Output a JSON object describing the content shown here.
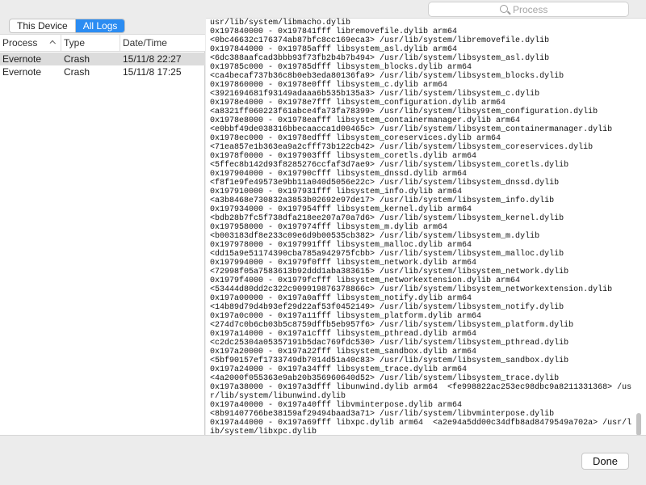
{
  "toolbar": {
    "segments": [
      "This Device",
      "All Logs"
    ],
    "active_segment": "All Logs",
    "search_placeholder": "Process"
  },
  "table": {
    "columns": [
      "Process",
      "Type",
      "Date/Time"
    ],
    "sort_column": "Process",
    "rows": [
      {
        "process": "Evernote",
        "type": "Crash",
        "datetime": "15/11/8 22:27",
        "selected": true
      },
      {
        "process": "Evernote",
        "type": "Crash",
        "datetime": "15/11/8 17:25",
        "selected": false
      }
    ]
  },
  "log_lines": [
    "usr/lib/system/libmacho.dylib",
    "0x197840000 - 0x197841fff libremovefile.dylib arm64",
    "<0bc46632c176374ab87bfc8cc169eca3> /usr/lib/system/libremovefile.dylib",
    "0x197844000 - 0x19785afff libsystem_asl.dylib arm64",
    "<6dc388aafcad3bbb93f73fb2b4b7b494> /usr/lib/system/libsystem_asl.dylib",
    "0x19785c000 - 0x19785dfff libsystem_blocks.dylib arm64",
    "<ca4becaf737b36c8b0eb3eda80136fa9> /usr/lib/system/libsystem_blocks.dylib",
    "0x197860000 - 0x1978e0fff libsystem_c.dylib arm64",
    "<3921694681f93149adaaa6b535b135a3> /usr/lib/system/libsystem_c.dylib",
    "0x1978e4000 - 0x1978e7fff libsystem_configuration.dylib arm64",
    "<a8321ff060223f61abce4fa73fa78399> /usr/lib/system/libsystem_configuration.dylib",
    "0x1978e8000 - 0x1978eafff libsystem_containermanager.dylib arm64",
    "<e0bbf49de038316bbecaacca1d00465c> /usr/lib/system/libsystem_containermanager.dylib",
    "0x1978ec000 - 0x1978edfff libsystem_coreservices.dylib arm64",
    "<71ea857e1b363ea9a2cfff73b122cb42> /usr/lib/system/libsystem_coreservices.dylib",
    "0x1978f0000 - 0x197903fff libsystem_coretls.dylib arm64",
    "<5ffec8b142d93f8285276ccfaf3d7ae9> /usr/lib/system/libsystem_coretls.dylib",
    "0x197904000 - 0x19790cfff libsystem_dnssd.dylib arm64",
    "<f8f1e9fe49573e9bb11a040d5056e22c> /usr/lib/system/libsystem_dnssd.dylib",
    "0x197910000 - 0x197931fff libsystem_info.dylib arm64",
    "<a3b8468e730832a3853b02692e97de17> /usr/lib/system/libsystem_info.dylib",
    "0x197934000 - 0x197954fff libsystem_kernel.dylib arm64",
    "<bdb28b7fc5f738dfa218ee207a70a7d6> /usr/lib/system/libsystem_kernel.dylib",
    "0x197958000 - 0x197974fff libsystem_m.dylib arm64",
    "<b003183df8e233c09e6d9b00535cb382> /usr/lib/system/libsystem_m.dylib",
    "0x197978000 - 0x197991fff libsystem_malloc.dylib arm64",
    "<dd15a9e51174390cba785a942975fcbb> /usr/lib/system/libsystem_malloc.dylib",
    "0x197994000 - 0x1979f0fff libsystem_network.dylib arm64",
    "<72998f05a7583613b92ddd1aba383615> /usr/lib/system/libsystem_network.dylib",
    "0x1979f4000 - 0x1979fcfff libsystem_networkextension.dylib arm64",
    "<53444d80dd2c322c909919876378866c> /usr/lib/system/libsystem_networkextension.dylib",
    "0x197a00000 - 0x197a0afff libsystem_notify.dylib arm64",
    "<14b89d79d4b93ef29d22af53f0452149> /usr/lib/system/libsystem_notify.dylib",
    "0x197a0c000 - 0x197a11fff libsystem_platform.dylib arm64",
    "<274d7c0b6cb03b5c8759dffb5eb957f6> /usr/lib/system/libsystem_platform.dylib",
    "0x197a14000 - 0x197a1cfff libsystem_pthread.dylib arm64",
    "<c2dc25304a05357191b5dac769fdc530> /usr/lib/system/libsystem_pthread.dylib",
    "0x197a20000 - 0x197a22fff libsystem_sandbox.dylib arm64",
    "<5bf90157ef1733749db7014d51a40c83> /usr/lib/system/libsystem_sandbox.dylib",
    "0x197a24000 - 0x197a34fff libsystem_trace.dylib arm64",
    "<4a2000f055363e9ab20b356960640d52> /usr/lib/system/libsystem_trace.dylib",
    "0x197a38000 - 0x197a3dfff libunwind.dylib arm64  <fe998822ac253ec98dbc9a8211331368> /usr/lib/system/libunwind.dylib",
    "0x197a40000 - 0x197a40fff libvminterpose.dylib arm64",
    "<8b91407766be38159af29494baad3a71> /usr/lib/system/libvminterpose.dylib",
    "0x197a44000 - 0x197a69fff libxpc.dylib arm64  <a2e94a5dd00c34dfb8ad8479549a702a> /usr/lib/system/libxpc.dylib"
  ],
  "footer": {
    "done_label": "Done"
  },
  "colors": {
    "accent": "#2b8cf2",
    "selected_row": "#dcdcdc"
  }
}
